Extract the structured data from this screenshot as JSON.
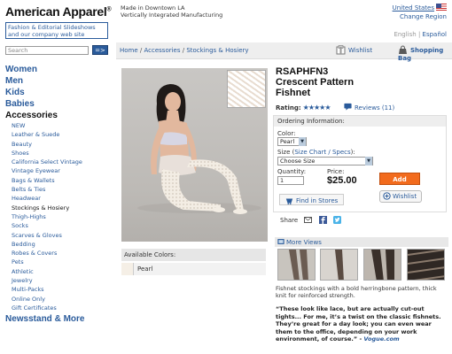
{
  "header": {
    "brand": "American Apparel",
    "brand_mark": "®",
    "tagline_1": "Made in Downtown LA",
    "tagline_2": "Vertically Integrated Manufacturing",
    "promo": "Fashion & Editorial Slideshows and our company web site",
    "country": "United States",
    "change_region": "Change Region",
    "lang_en": "English",
    "lang_sep": " | ",
    "lang_es": "Español"
  },
  "search": {
    "placeholder": "Search",
    "button": "=>"
  },
  "breadcrumb": {
    "home": "Home",
    "sep": " / ",
    "accessories": "Accessories",
    "category": "Stockings & Hosiery",
    "wishlist": "Wishlist",
    "bag": "Shopping Bag"
  },
  "sidebar": {
    "top_categories": [
      "Women",
      "Men",
      "Kids",
      "Babies"
    ],
    "active_category": "Accessories",
    "sub_items": [
      "NEW",
      "Leather & Suede",
      "Beauty",
      "Shoes",
      "California Select Vintage",
      "Vintage Eyewear",
      "Bags & Wallets",
      "Belts & Ties",
      "Headwear",
      "Stockings & Hosiery",
      "Thigh-Highs",
      "Socks",
      "Scarves & Gloves",
      "Bedding",
      "Robes & Covers",
      "Pets",
      "Athletic",
      "Jewelry",
      "Multi-Packs",
      "Online Only",
      "Gift Certificates"
    ],
    "selected_sub": "Stockings & Hosiery",
    "newsstand": "Newsstand & More"
  },
  "product": {
    "sku": "RSAPHFN3",
    "name_1": "Crescent Pattern",
    "name_2": "Fishnet",
    "rating_label": "Rating:",
    "stars": "★★★★★",
    "reviews": "Reviews (11)",
    "ordering_label": "Ordering Information:",
    "color_label": "Color:",
    "color_value": "Pearl",
    "size_label": "Size (",
    "size_chart_link": "Size Chart / Specs",
    "size_label_end": "):",
    "size_value": "Choose Size",
    "quantity_label": "Quantity:",
    "quantity_value": "1",
    "price_label": "Price:",
    "price": "$25.00",
    "add_button": "Add",
    "wishlist_button": "Wishlist",
    "find_stores": "Find in Stores",
    "share_label": "Share",
    "available_colors_label": "Available Colors:",
    "available_colors": [
      "Pearl"
    ],
    "more_views": "More Views",
    "description": "Fishnet stockings with a bold herringbone pattern, thick knit for reinforced strength.",
    "quote": "“These look like lace, but are actually cut-out tights... For me, it’s a twist on the classic fishnets. They’re great for a day look; you can even wear them to the office, depending on your work environment, of course.”",
    "quote_dash": " - ",
    "quote_source": "Vogue.com"
  },
  "colors": {
    "accent": "#2a5b9b",
    "add_button": "#f26b1d",
    "pearl": "#f5efe6"
  },
  "icons": [
    "flag-us-icon",
    "search-submit-icon",
    "wishlist-icon",
    "shopping-bag-icon",
    "email-icon",
    "facebook-icon",
    "twitter-icon",
    "find-stores-icon",
    "more-views-icon"
  ]
}
